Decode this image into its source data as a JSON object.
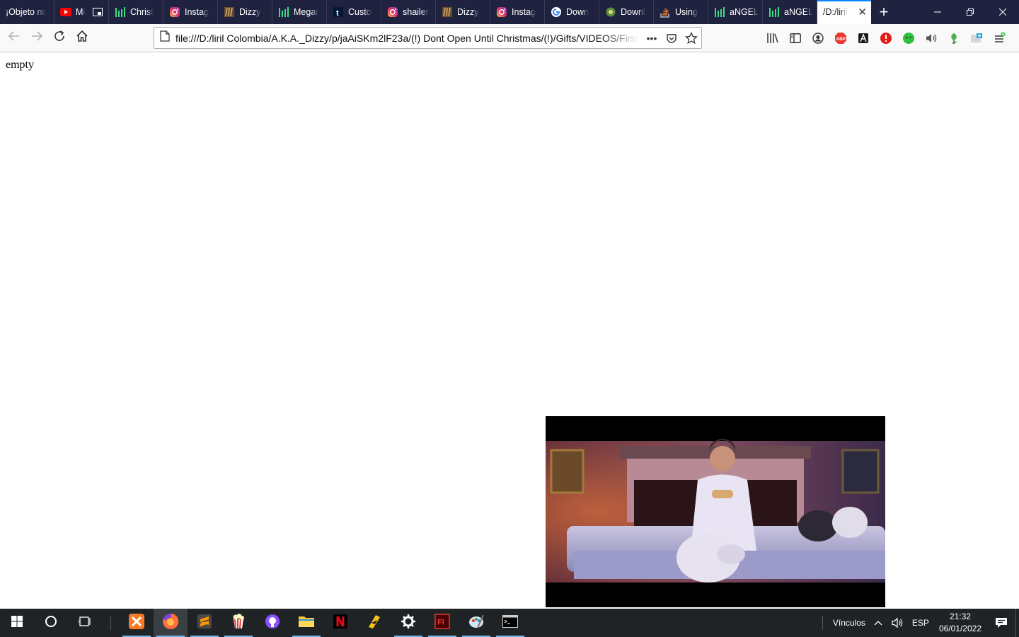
{
  "browser": {
    "tabs": [
      {
        "title": "¡Objeto no",
        "icon": "none"
      },
      {
        "title": "Mi",
        "icon": "youtube-icon"
      },
      {
        "title": "Christ",
        "icon": "stats-icon"
      },
      {
        "title": "Instag",
        "icon": "instagram-icon"
      },
      {
        "title": "Dizzy",
        "icon": "dizzy-icon"
      },
      {
        "title": "Megar",
        "icon": "stats-icon"
      },
      {
        "title": "Custo",
        "icon": "tumblr-icon"
      },
      {
        "title": "shailer",
        "icon": "instagram-icon"
      },
      {
        "title": "Dizzy",
        "icon": "dizzy-icon"
      },
      {
        "title": "Instag",
        "icon": "instagram-icon"
      },
      {
        "title": "Down",
        "icon": "google-icon"
      },
      {
        "title": "Downl",
        "icon": "download-site-icon"
      },
      {
        "title": "Using",
        "icon": "stackoverflow-icon"
      },
      {
        "title": "aNGEL",
        "icon": "stats-icon"
      },
      {
        "title": "aNGEL",
        "icon": "stats-icon"
      }
    ],
    "active_tab": {
      "title": "/D:/liril"
    },
    "url": "file:///D:/liril Colombia/A.K.A._Dizzy/p/jaAiSKm2lF23a/(!) Dont Open Until Christmas/(!)/Gifts/VIDEOS/First Vi"
  },
  "page": {
    "text": "empty"
  },
  "taskbar": {
    "tray_label": "Vínculos",
    "language": "ESP",
    "time": "21:32",
    "date": "06/01/2022"
  },
  "colors": {
    "tabstrip": "#202340",
    "accent": "#0a84ff",
    "taskbar": "#1f2326"
  }
}
